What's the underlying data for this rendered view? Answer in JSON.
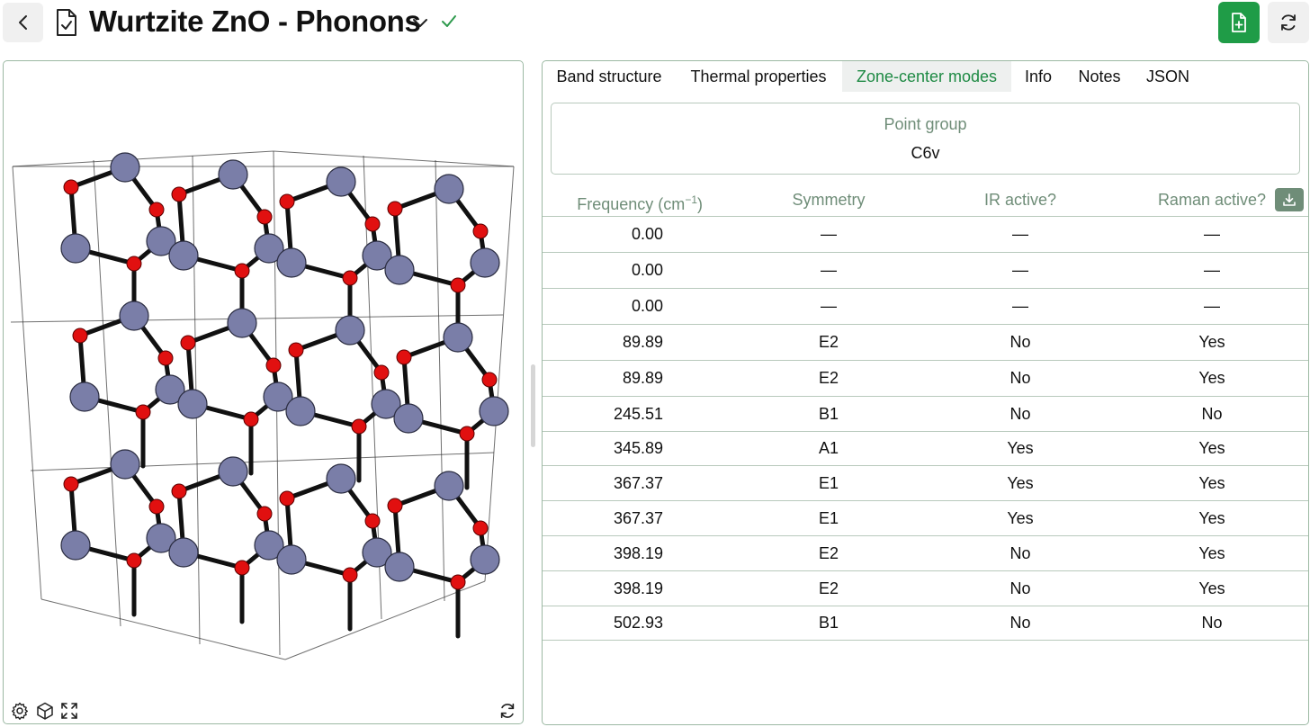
{
  "header": {
    "title": "Wurtzite ZnO - Phonons",
    "icons": {
      "back": "chevron-left-icon",
      "document": "document-check-icon",
      "dropdown": "chevron-down-icon",
      "status": "checkmark-icon",
      "new_document": "document-plus-icon",
      "refresh": "refresh-icon"
    },
    "colors": {
      "accent": "#1f9c47",
      "status": "#2e9a4d"
    }
  },
  "viewer": {
    "toolbar_icons": [
      "settings-icon",
      "cube-icon",
      "fullscreen-icon"
    ],
    "reset_icon": "refresh-icon",
    "atom_colors": {
      "Zn": "#7a7ea8",
      "O": "#e11010"
    }
  },
  "tabs": [
    {
      "label": "Band structure",
      "active": false
    },
    {
      "label": "Thermal properties",
      "active": false
    },
    {
      "label": "Zone-center modes",
      "active": true
    },
    {
      "label": "Info",
      "active": false
    },
    {
      "label": "Notes",
      "active": false
    },
    {
      "label": "JSON",
      "active": false
    }
  ],
  "point_group": {
    "label": "Point group",
    "value": "C6v"
  },
  "table": {
    "headers": {
      "frequency_prefix": "Frequency (cm",
      "frequency_sup": "−1",
      "frequency_suffix": ")",
      "symmetry": "Symmetry",
      "ir": "IR active?",
      "raman": "Raman active?"
    },
    "download_icon": "download-icon",
    "rows": [
      {
        "freq": "0.00",
        "sym": "—",
        "ir": "—",
        "raman": "—"
      },
      {
        "freq": "0.00",
        "sym": "—",
        "ir": "—",
        "raman": "—"
      },
      {
        "freq": "0.00",
        "sym": "—",
        "ir": "—",
        "raman": "—"
      },
      {
        "freq": "89.89",
        "sym": "E2",
        "ir": "No",
        "raman": "Yes"
      },
      {
        "freq": "89.89",
        "sym": "E2",
        "ir": "No",
        "raman": "Yes"
      },
      {
        "freq": "245.51",
        "sym": "B1",
        "ir": "No",
        "raman": "No"
      },
      {
        "freq": "345.89",
        "sym": "A1",
        "ir": "Yes",
        "raman": "Yes"
      },
      {
        "freq": "367.37",
        "sym": "E1",
        "ir": "Yes",
        "raman": "Yes"
      },
      {
        "freq": "367.37",
        "sym": "E1",
        "ir": "Yes",
        "raman": "Yes"
      },
      {
        "freq": "398.19",
        "sym": "E2",
        "ir": "No",
        "raman": "Yes"
      },
      {
        "freq": "398.19",
        "sym": "E2",
        "ir": "No",
        "raman": "Yes"
      },
      {
        "freq": "502.93",
        "sym": "B1",
        "ir": "No",
        "raman": "No"
      }
    ]
  }
}
